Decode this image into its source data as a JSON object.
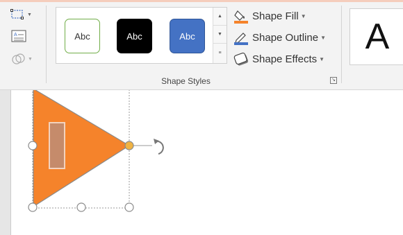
{
  "ribbon": {
    "left_tools": [
      {
        "name": "edit-shape",
        "icon": "edit-points-icon"
      },
      {
        "name": "text-box",
        "icon": "text-box-icon"
      },
      {
        "name": "merge-shapes",
        "icon": "merge-shapes-icon"
      }
    ],
    "shape_styles": {
      "swatches": [
        {
          "label": "Abc",
          "fill": "#ffffff",
          "border": "#70ad47",
          "text_color": "#333333"
        },
        {
          "label": "Abc",
          "fill": "#000000",
          "border": "#000000",
          "text_color": "#ffffff"
        },
        {
          "label": "Abc",
          "fill": "#4472c4",
          "border": "#2f5597",
          "text_color": "#ffffff"
        }
      ],
      "commands": [
        {
          "label": "Shape Fill",
          "icon": "paint-bucket-icon"
        },
        {
          "label": "Shape Outline",
          "icon": "pen-outline-icon"
        },
        {
          "label": "Shape Effects",
          "icon": "shape-effects-icon"
        }
      ],
      "group_label": "Shape Styles"
    },
    "wordart": {
      "sample": "A"
    }
  },
  "canvas": {
    "shape": {
      "type": "triangle",
      "fill": "#f5832b",
      "inner_rect_fill": "#c58b6b"
    }
  },
  "colors": {
    "accent": "#f5832b",
    "ribbon_bg": "#f3f3f3",
    "fill_bar": "#f5832b",
    "outline_bar": "#4472c4"
  }
}
